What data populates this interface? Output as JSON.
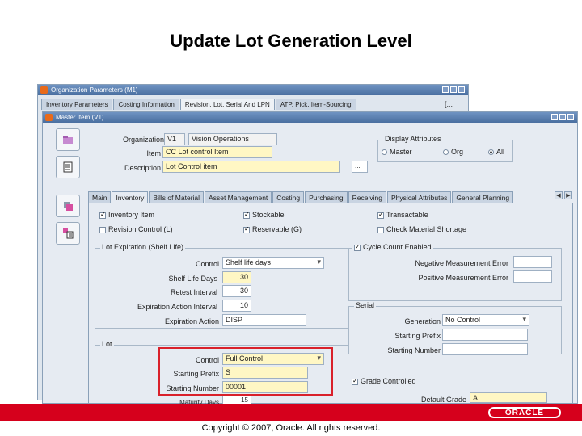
{
  "slide": {
    "title": "Update Lot Generation Level",
    "copyright": "Copyright © 2007, Oracle. All rights reserved.",
    "logo_text": "ORACLE"
  },
  "bg_window": {
    "title": "Organization Parameters (M1)",
    "tabs": [
      "Inventory Parameters",
      "Costing Information",
      "Revision, Lot, Serial And LPN",
      "ATP, Pick, Item-Sourcing"
    ],
    "active_tab": "Revision, Lot, Serial And LPN",
    "right_fragment": "[..."
  },
  "item_window": {
    "title": "Master Item (V1)",
    "organization_label": "Organization",
    "organization_code": "V1",
    "organization_name": "Vision Operations",
    "item_label": "Item",
    "item_value": "CC Lot control Item",
    "description_label": "Description",
    "description_value": "Lot Control item",
    "display_attributes": {
      "title": "Display Attributes",
      "options": [
        "Master",
        "Org",
        "All"
      ],
      "selected": "All"
    },
    "tabs": [
      "Main",
      "Inventory",
      "Bills of Material",
      "Asset Management",
      "Costing",
      "Purchasing",
      "Receiving",
      "Physical Attributes",
      "General Planning"
    ],
    "active_tab": "Inventory",
    "checkboxes": {
      "inventory_item": {
        "label": "Inventory Item",
        "checked": true
      },
      "stockable": {
        "label": "Stockable",
        "checked": true
      },
      "transactable": {
        "label": "Transactable",
        "checked": true
      },
      "revision_control": {
        "label": "Revision Control (L)",
        "checked": false
      },
      "reservable": {
        "label": "Reservable (G)",
        "checked": true
      },
      "check_material_shortage": {
        "label": "Check Material Shortage",
        "checked": false
      },
      "cycle_count_enabled": {
        "label": "Cycle Count Enabled",
        "checked": true
      },
      "grade_controlled": {
        "label": "Grade Controlled",
        "checked": true
      }
    },
    "lot_expiration": {
      "title": "Lot Expiration (Shelf Life)",
      "control_label": "Control",
      "control_value": "Shelf life days",
      "shelf_life_days_label": "Shelf Life Days",
      "shelf_life_days_value": "30",
      "retest_interval_label": "Retest Interval",
      "retest_interval_value": "30",
      "expiration_action_interval_label": "Expiration Action Interval",
      "expiration_action_interval_value": "10",
      "expiration_action_label": "Expiration Action",
      "expiration_action_value": "DISP"
    },
    "cycle_count": {
      "negative_label": "Negative Measurement Error",
      "positive_label": "Positive Measurement Error"
    },
    "serial": {
      "title": "Serial",
      "generation_label": "Generation",
      "generation_value": "No Control",
      "starting_prefix_label": "Starting Prefix",
      "starting_number_label": "Starting Number"
    },
    "lot": {
      "title": "Lot",
      "control_label": "Control",
      "control_value": "Full Control",
      "starting_prefix_label": "Starting Prefix",
      "starting_prefix_value": "S",
      "starting_number_label": "Starting Number",
      "starting_number_value": "00001",
      "maturity_days_label": "Maturity Days",
      "maturity_days_value": "15"
    },
    "grade": {
      "default_grade_label": "Default Grade",
      "default_grade_value": "A"
    }
  },
  "colors": {
    "highlight_box": "#d9202a",
    "footer_bar": "#d6001c",
    "required_field": "#fff7c4"
  }
}
